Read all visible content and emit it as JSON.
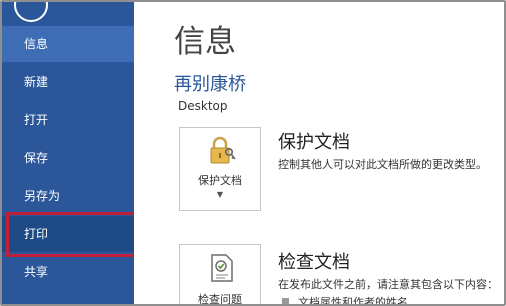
{
  "sidebar": {
    "items": [
      {
        "label": "信息"
      },
      {
        "label": "新建"
      },
      {
        "label": "打开"
      },
      {
        "label": "保存"
      },
      {
        "label": "另存为"
      },
      {
        "label": "打印"
      },
      {
        "label": "共享"
      }
    ]
  },
  "main": {
    "title": "信息",
    "doc_name": "再别康桥",
    "doc_path": "Desktop",
    "protect": {
      "card_label": "保护文档",
      "title": "保护文档",
      "description": "控制其他人可以对此文档所做的更改类型。"
    },
    "inspect": {
      "card_label": "检查问题",
      "title": "检查文档",
      "description": "在发布此文件之前，请注意其包含以下内容：",
      "sub_item": "文档属性和作者的姓名"
    }
  },
  "colors": {
    "sidebar": "#2b579a",
    "sidebar_active": "#3e6db5",
    "highlight_border": "#c0203a",
    "title_accent": "#2b579a"
  },
  "icons": [
    "back-arrow-icon",
    "lock-key-icon",
    "inspect-document-icon",
    "caret-down-icon"
  ]
}
